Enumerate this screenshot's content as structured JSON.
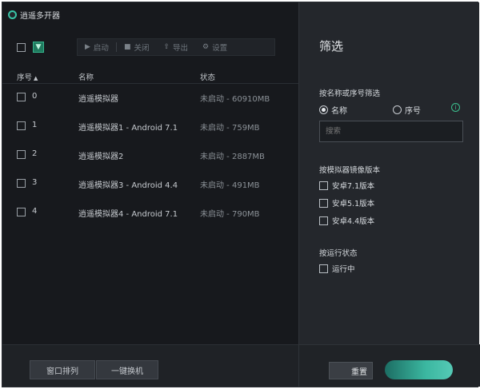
{
  "window": {
    "title": "逍遥多开器"
  },
  "toolbar": {
    "start_label": "启动",
    "close_label": "关闭",
    "export_label": "导出",
    "settings_label": "设置"
  },
  "table": {
    "headers": {
      "index": "序号",
      "name": "名称",
      "status": "状态"
    },
    "rows": [
      {
        "index": "0",
        "name": "逍遥模拟器",
        "status": "未启动 - 60910MB"
      },
      {
        "index": "1",
        "name": "逍遥模拟器1 - Android 7.1",
        "status": "未启动 - 759MB"
      },
      {
        "index": "2",
        "name": "逍遥模拟器2",
        "status": "未启动 - 2887MB"
      },
      {
        "index": "3",
        "name": "逍遥模拟器3 - Android 4.4",
        "status": "未启动 - 491MB"
      },
      {
        "index": "4",
        "name": "逍遥模拟器4 - Android 7.1",
        "status": "未启动 - 790MB"
      }
    ]
  },
  "bottom": {
    "arrange_label": "窗口排列",
    "switch_label": "一键换机"
  },
  "filter": {
    "title": "筛选",
    "by_name_section": "按名称或序号筛选",
    "radio_name": "名称",
    "radio_index": "序号",
    "search_placeholder": "搜索",
    "by_version_section": "按模拟器镜像版本",
    "version_options": [
      "安卓7.1版本",
      "安卓5.1版本",
      "安卓4.4版本"
    ],
    "by_status_section": "按运行状态",
    "status_options": [
      "运行中"
    ],
    "reset_label": "重置",
    "confirm_label": ""
  },
  "colors": {
    "accent": "#3cc08e",
    "background": "#17191d",
    "panel": "#24272c"
  }
}
